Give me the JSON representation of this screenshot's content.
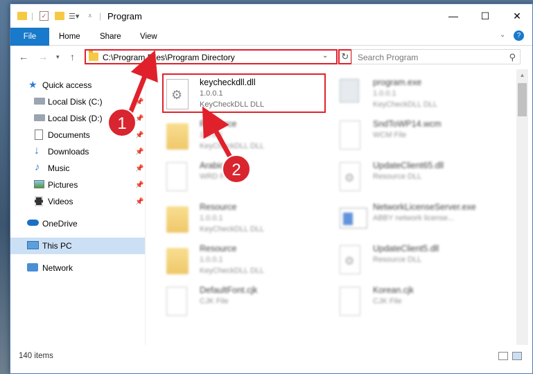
{
  "window": {
    "title": "Program",
    "controls": {
      "minimize": "—",
      "maximize": "☐",
      "close": "✕"
    }
  },
  "ribbon": {
    "tabs": [
      "File",
      "Home",
      "Share",
      "View"
    ],
    "help": "?"
  },
  "navigation": {
    "address": "C:\\Program Files\\Program Directory",
    "search_placeholder": "Search Program"
  },
  "sidebar": {
    "items": [
      {
        "label": "Quick access",
        "icon": "star-icon"
      },
      {
        "label": "Local Disk (C:)",
        "icon": "drive-icon",
        "pinned": true
      },
      {
        "label": "Local Disk (D:)",
        "icon": "drive-icon",
        "pinned": true
      },
      {
        "label": "Documents",
        "icon": "documents-icon",
        "pinned": true
      },
      {
        "label": "Downloads",
        "icon": "download-arrow-icon",
        "pinned": true
      },
      {
        "label": "Music",
        "icon": "music-note-icon",
        "pinned": true
      },
      {
        "label": "Pictures",
        "icon": "pictures-icon",
        "pinned": true
      },
      {
        "label": "Videos",
        "icon": "film-icon",
        "pinned": true
      },
      {
        "label": "OneDrive",
        "icon": "cloud-icon"
      },
      {
        "label": "This PC",
        "icon": "monitor-icon",
        "selected": true
      },
      {
        "label": "Network",
        "icon": "network-icon"
      }
    ]
  },
  "files": [
    {
      "name": "keycheckdll.dll",
      "line1": "1.0.0.1",
      "line2": "KeyCheckDLL DLL",
      "icon": "dll-gear-icon",
      "highlighted": true
    },
    {
      "name": "program.exe",
      "line1": "1.0.0.1",
      "line2": "KeyCheckDLL DLL",
      "icon": "exe-icon"
    },
    {
      "name": "Resource",
      "line1": "1.0.0.1",
      "line2": "KeyCheckDLL DLL",
      "icon": "folder-doc-icon"
    },
    {
      "name": "SndToWP14.wcm",
      "line1": "WCM File",
      "line2": "",
      "icon": "blank-doc-icon"
    },
    {
      "name": "Arabic.wrd",
      "line1": "WRD File",
      "line2": "",
      "icon": "blank-doc-icon"
    },
    {
      "name": "UpdateClient65.dll",
      "line1": "Resource DLL",
      "line2": "",
      "icon": "dll-gear-icon"
    },
    {
      "name": "Resource",
      "line1": "1.0.0.1",
      "line2": "KeyCheckDLL DLL",
      "icon": "folder-doc-icon"
    },
    {
      "name": "NetworkLicenseServer.exe",
      "line1": "ABBY network license...",
      "line2": "",
      "icon": "app-window-icon"
    },
    {
      "name": "Resource",
      "line1": "1.0.0.1",
      "line2": "KeyCheckDLL DLL",
      "icon": "folder-doc-icon"
    },
    {
      "name": "UpdateClient5.dll",
      "line1": "Resource DLL",
      "line2": "",
      "icon": "dll-gear-icon"
    },
    {
      "name": "DefaultFont.cjk",
      "line1": "CJK File",
      "line2": "",
      "icon": "blank-doc-icon"
    },
    {
      "name": "Korean.cjk",
      "line1": "CJK File",
      "line2": "",
      "icon": "blank-doc-icon"
    }
  ],
  "annotations": {
    "step1": "1",
    "step2": "2"
  },
  "status": {
    "items": "140 items"
  },
  "colors": {
    "accent": "#1979ca",
    "highlight": "#e0212b",
    "selected": "#cce0f5"
  }
}
